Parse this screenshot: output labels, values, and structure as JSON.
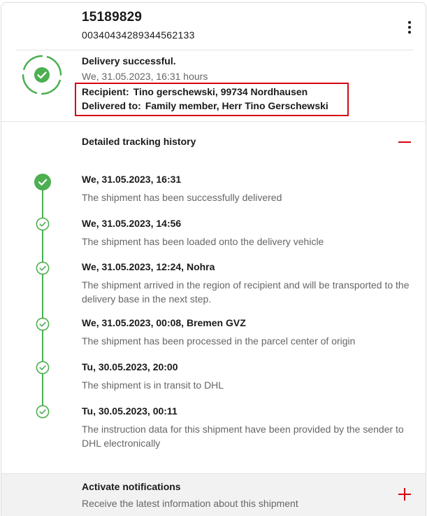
{
  "shipment": {
    "id": "15189829",
    "tracking_number": "00340434289344562133"
  },
  "status": {
    "title": "Delivery successful.",
    "time": "We, 31.05.2023, 16:31 hours",
    "recipient_label": "Recipient:",
    "recipient_value": "Tino gerschewski, 99734 Nordhausen",
    "delivered_to_label": "Delivered to:",
    "delivered_to_value": "Family member, Herr Tino Gerschewski",
    "icon": "check-circle-icon",
    "color": "#4caf50",
    "highlight_color": "#d40511"
  },
  "history": {
    "title": "Detailed tracking history",
    "events": [
      {
        "date": "We, 31.05.2023, 16:31",
        "desc": "The shipment has been successfully delivered"
      },
      {
        "date": "We, 31.05.2023, 14:56",
        "desc": "The shipment has been loaded onto the delivery vehicle"
      },
      {
        "date": "We, 31.05.2023, 12:24, Nohra",
        "desc": "The shipment arrived in the region of recipient and will be transported to the delivery base in the next step."
      },
      {
        "date": "We, 31.05.2023, 00:08, Bremen GVZ",
        "desc": "The shipment has been processed in the parcel center of origin"
      },
      {
        "date": "Tu, 30.05.2023, 20:00",
        "desc": "The shipment is in transit to DHL"
      },
      {
        "date": "Tu, 30.05.2023, 00:11",
        "desc": "The instruction data for this shipment have been provided by the sender to DHL electronically"
      }
    ]
  },
  "notifications": {
    "title": "Activate notifications",
    "subtitle": "Receive the latest information about this shipment"
  }
}
